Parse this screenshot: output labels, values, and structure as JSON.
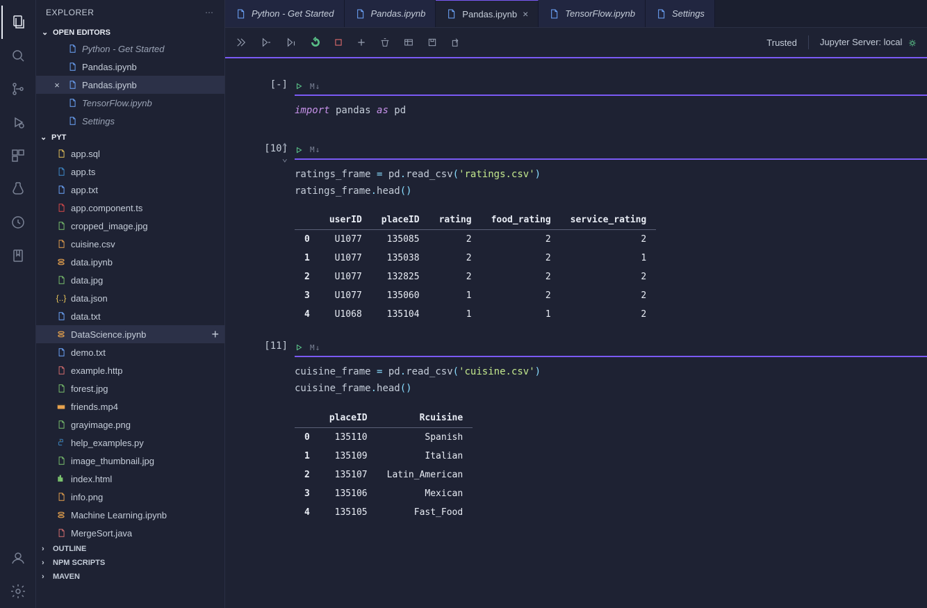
{
  "explorer": {
    "title": "EXPLORER",
    "open_editors_label": "OPEN EDITORS",
    "open_editors": [
      {
        "label": "Python - Get Started",
        "italic": true,
        "selected": false,
        "close": false
      },
      {
        "label": "Pandas.ipynb",
        "italic": false,
        "selected": false,
        "close": false
      },
      {
        "label": "Pandas.ipynb",
        "italic": false,
        "selected": true,
        "close": true
      },
      {
        "label": "TensorFlow.ipynb",
        "italic": true,
        "selected": false,
        "close": false
      },
      {
        "label": "Settings",
        "italic": true,
        "selected": false,
        "close": false
      }
    ],
    "folder_label": "PYT",
    "files": [
      {
        "label": "app.sql",
        "icon": "db",
        "c": "#e8c55a"
      },
      {
        "label": "app.ts",
        "icon": "ts",
        "c": "#3f8ed0"
      },
      {
        "label": "app.txt",
        "icon": "txt",
        "c": "#6fa8ff"
      },
      {
        "label": "app.component.ts",
        "icon": "ng",
        "c": "#dd4b4b"
      },
      {
        "label": "cropped_image.jpg",
        "icon": "img",
        "c": "#7bc36e"
      },
      {
        "label": "cuisine.csv",
        "icon": "csv",
        "c": "#e8a34e"
      },
      {
        "label": "data.ipynb",
        "icon": "jup",
        "c": "#e8a34e"
      },
      {
        "label": "data.jpg",
        "icon": "img",
        "c": "#7bc36e"
      },
      {
        "label": "data.json",
        "icon": "json",
        "c": "#e8c55a"
      },
      {
        "label": "data.txt",
        "icon": "txt",
        "c": "#6fa8ff"
      },
      {
        "label": "DataScience.ipynb",
        "icon": "jup",
        "c": "#e8a34e",
        "selected": true,
        "showAdd": true
      },
      {
        "label": "demo.txt",
        "icon": "txt",
        "c": "#6fa8ff"
      },
      {
        "label": "example.http",
        "icon": "http",
        "c": "#d96f6f"
      },
      {
        "label": "forest.jpg",
        "icon": "img",
        "c": "#7bc36e"
      },
      {
        "label": "friends.mp4",
        "icon": "vid",
        "c": "#e8a34e"
      },
      {
        "label": "grayimage.png",
        "icon": "img",
        "c": "#7bc36e"
      },
      {
        "label": "help_examples.py",
        "icon": "py",
        "c": "#ffd43b"
      },
      {
        "label": "image_thumbnail.jpg",
        "icon": "img",
        "c": "#7bc36e"
      },
      {
        "label": "index.html",
        "icon": "html",
        "c": "#7bc36e"
      },
      {
        "label": "info.png",
        "icon": "img",
        "c": "#e8a34e"
      },
      {
        "label": "Machine Learning.ipynb",
        "icon": "jup",
        "c": "#e8a34e"
      },
      {
        "label": "MergeSort.java",
        "icon": "java",
        "c": "#d96f6f"
      }
    ],
    "bottom": [
      "OUTLINE",
      "NPM SCRIPTS",
      "MAVEN"
    ]
  },
  "tabs": [
    {
      "label": "Python - Get Started",
      "italic": true,
      "active": false,
      "close": false
    },
    {
      "label": "Pandas.ipynb",
      "italic": true,
      "active": false,
      "close": false
    },
    {
      "label": "Pandas.ipynb",
      "italic": false,
      "active": true,
      "close": true
    },
    {
      "label": "TensorFlow.ipynb",
      "italic": true,
      "active": false,
      "close": false
    },
    {
      "label": "Settings",
      "italic": true,
      "active": false,
      "close": false
    }
  ],
  "toolbar": {
    "trusted": "Trusted",
    "server": "Jupyter Server: local"
  },
  "cells": [
    {
      "prompt": "[-]",
      "code": [
        {
          "t": "kw",
          "v": "import"
        },
        {
          "t": "",
          "v": " pandas "
        },
        {
          "t": "kw",
          "v": "as"
        },
        {
          "t": "",
          "v": " pd"
        }
      ]
    },
    {
      "prompt": "[10]",
      "showFold": true,
      "code_lines": [
        [
          {
            "t": "",
            "v": "ratings_frame "
          },
          {
            "t": "op",
            "v": "="
          },
          {
            "t": "",
            "v": " pd"
          },
          {
            "t": "op",
            "v": "."
          },
          {
            "t": "",
            "v": "read_csv"
          },
          {
            "t": "op",
            "v": "("
          },
          {
            "t": "str",
            "v": "'ratings.csv'"
          },
          {
            "t": "op",
            "v": ")"
          }
        ],
        [
          {
            "t": "",
            "v": "ratings_frame"
          },
          {
            "t": "op",
            "v": "."
          },
          {
            "t": "",
            "v": "head"
          },
          {
            "t": "op",
            "v": "()"
          }
        ]
      ],
      "df": {
        "columns": [
          "userID",
          "placeID",
          "rating",
          "food_rating",
          "service_rating"
        ],
        "index": [
          "0",
          "1",
          "2",
          "3",
          "4"
        ],
        "rows": [
          [
            "U1077",
            "135085",
            "2",
            "2",
            "2"
          ],
          [
            "U1077",
            "135038",
            "2",
            "2",
            "1"
          ],
          [
            "U1077",
            "132825",
            "2",
            "2",
            "2"
          ],
          [
            "U1077",
            "135060",
            "1",
            "2",
            "2"
          ],
          [
            "U1068",
            "135104",
            "1",
            "1",
            "2"
          ]
        ]
      }
    },
    {
      "prompt": "[11]",
      "code_lines": [
        [
          {
            "t": "",
            "v": "cuisine_frame "
          },
          {
            "t": "op",
            "v": "="
          },
          {
            "t": "",
            "v": " pd"
          },
          {
            "t": "op",
            "v": "."
          },
          {
            "t": "",
            "v": "read_csv"
          },
          {
            "t": "op",
            "v": "("
          },
          {
            "t": "str",
            "v": "'cuisine.csv'"
          },
          {
            "t": "op",
            "v": ")"
          }
        ],
        [
          {
            "t": "",
            "v": "cuisine_frame"
          },
          {
            "t": "op",
            "v": "."
          },
          {
            "t": "",
            "v": "head"
          },
          {
            "t": "op",
            "v": "()"
          }
        ]
      ],
      "df": {
        "columns": [
          "placeID",
          "Rcuisine"
        ],
        "index": [
          "0",
          "1",
          "2",
          "3",
          "4"
        ],
        "rows": [
          [
            "135110",
            "Spanish"
          ],
          [
            "135109",
            "Italian"
          ],
          [
            "135107",
            "Latin_American"
          ],
          [
            "135106",
            "Mexican"
          ],
          [
            "135105",
            "Fast_Food"
          ]
        ]
      }
    }
  ]
}
